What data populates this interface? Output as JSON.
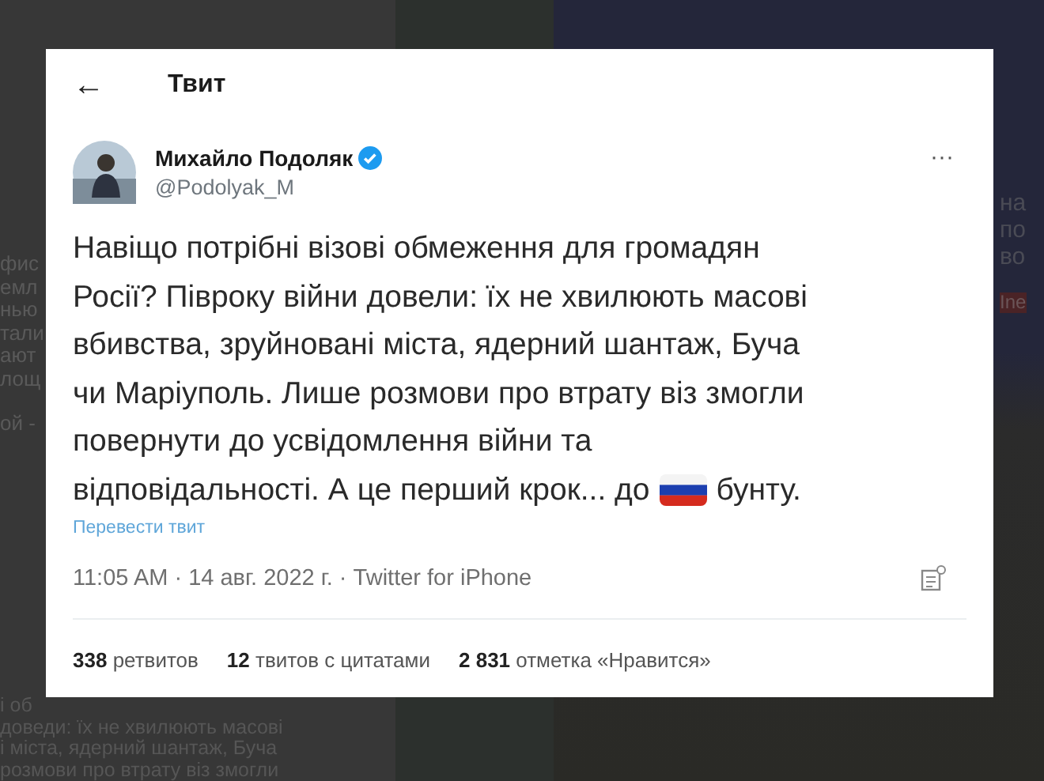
{
  "background": {
    "left_fragments": [
      "фис",
      "емл",
      "нью",
      "тали",
      "ают",
      "лощ",
      "ой -"
    ],
    "lower_fragments": [
      "і об",
      "доведи: їх не хвилюють масові",
      "і міста, ядерний шантаж, Буча",
      "розмови про втрату віз змогли"
    ],
    "right_fragments": [
      "на",
      "по",
      "во"
    ],
    "right_tag": "Ine"
  },
  "tweet": {
    "back_icon": "←",
    "title": "Твит",
    "author": {
      "name": "Михайло Подоляк",
      "verified": true,
      "handle": "@Podolyak_M"
    },
    "more": "···",
    "text_lines": [
      "Навіщо потрібні візові обмеження для громадян",
      "Росії? Півроку війни довели: їх не хвилюють масові",
      "вбивства, зруйновані міста, ядерний шантаж, Буча",
      "чи Маріуполь. Лише розмови про втрату віз змогли",
      "повернути до усвідомлення війни та"
    ],
    "last_line": {
      "before": "відповідальності. А це перший крок... до",
      "after": "бунту."
    },
    "translate_link": "Перевести твит",
    "meta": "11:05 AM · 14 авг. 2022 г. · Twitter for iPhone",
    "stats": [
      {
        "count": "338",
        "label": "ретвитов"
      },
      {
        "count": "12",
        "label": "твитов с цитатами"
      },
      {
        "count": "2 831",
        "label": "отметка «Нравится»"
      }
    ]
  }
}
